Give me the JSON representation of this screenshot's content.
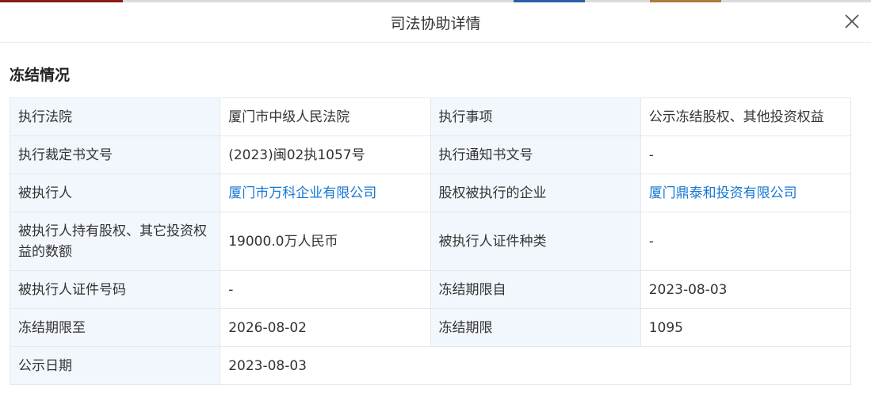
{
  "dialog": {
    "title": "司法协助详情"
  },
  "section": {
    "title": "冻结情况"
  },
  "rows": [
    [
      "执行法院",
      "厦门市中级人民法院",
      "执行事项",
      "公示冻结股权、其他投资权益"
    ],
    [
      "执行裁定书文号",
      "(2023)闽02执1057号",
      "执行通知书文号",
      "-"
    ],
    [
      "被执行人",
      "厦门市万科企业有限公司",
      "股权被执行的企业",
      "厦门鼎泰和投资有限公司"
    ],
    [
      "被执行人持有股权、其它投资权益的数额",
      "19000.0万人民币",
      "被执行人证件种类",
      "-"
    ],
    [
      "被执行人证件号码",
      "-",
      "冻结期限自",
      "2023-08-03"
    ],
    [
      "冻结期限至",
      "2026-08-02",
      "冻结期限",
      "1095"
    ],
    [
      "公示日期",
      "2023-08-03",
      "",
      ""
    ]
  ],
  "colors": {
    "label_bg": "#f2f7fd",
    "border": "#e3e8ef",
    "link": "#1677d2"
  }
}
